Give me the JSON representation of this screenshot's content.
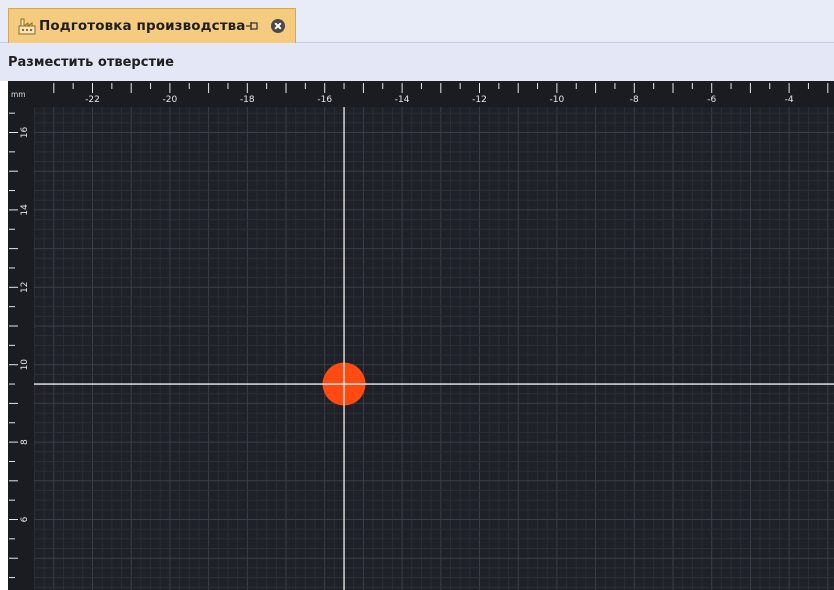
{
  "tab": {
    "icon": "factory-icon",
    "title": "Подготовка производства",
    "pin_icon": "pin-icon",
    "close_icon": "close-icon"
  },
  "panel": {
    "title": "Разместить отверстие"
  },
  "canvas": {
    "background": "#1e2127",
    "unit": "mm",
    "x_ticks": [
      "-22",
      "-20",
      "-18",
      "-16",
      "-14",
      "-12",
      "-10",
      "-8",
      "-6",
      "-4"
    ],
    "y_ticks": [
      "16",
      "14",
      "12",
      "10",
      "8",
      "6"
    ],
    "cursor": {
      "x": -15.5,
      "y": 9.5
    },
    "hole": {
      "color": "#ff4a12"
    },
    "crosshair_color": "#f0f0f0"
  }
}
